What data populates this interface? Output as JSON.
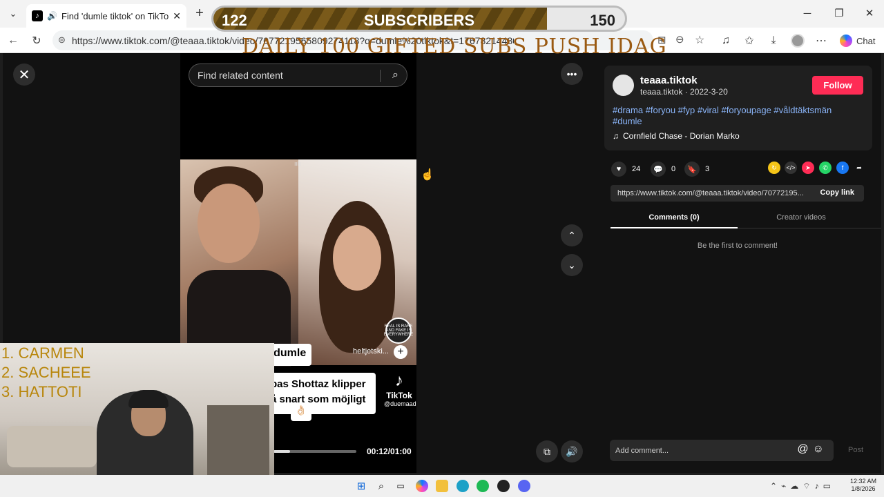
{
  "browser": {
    "tab_title": "Find 'dumle tiktok' on TikTok |",
    "url": "https://www.tiktok.com/@teaaa.tiktok/video/7077219565809274118?q=dumle%20tiktok&t=1767821448003",
    "chat_label": "Chat"
  },
  "overlay": {
    "sub_current": "122",
    "sub_label": "SUBSCRIBERS",
    "sub_goal": "150",
    "sub_progress": 0.81,
    "daily_text": "DAILY 100  GIFTED SUBS PUSH IDAG",
    "ranks": [
      "1.  CARMEN",
      "2.  SACHEEE",
      "3.  HATTOTI"
    ]
  },
  "video": {
    "search_placeholder": "Find related content",
    "caption_1": "är in i dumle",
    "caption_2_line1": "bas Shottaz klipper",
    "caption_2_line2": "å snart som möjligt",
    "caption_3": "👌🏻",
    "watermark_brand": "TikTok",
    "watermark_handle": "@duemaad",
    "handle_overlay": "heltjetski...",
    "badge_text": "REAL IS RARE AND FAKE IS EVERYWHERE",
    "time": "00:12/01:00",
    "progress": 0.2
  },
  "post": {
    "username": "teaaa.tiktok",
    "subline": "teaaa.tiktok · 2022-3-20",
    "follow_label": "Follow",
    "hashtags": "#drama #foryou #fyp #viral #foryoupage #våldtäktsmän #dumle",
    "music": "Cornfield Chase - Dorian Marko",
    "likes": "24",
    "comments": "0",
    "saves": "3",
    "link": "https://www.tiktok.com/@teaaa.tiktok/video/70772195...",
    "copy_label": "Copy link",
    "tab_comments": "Comments (0)",
    "tab_creator": "Creator videos",
    "empty_comments": "Be the first to comment!",
    "add_comment_placeholder": "Add comment...",
    "post_label": "Post"
  },
  "taskbar": {
    "time": "12:32 AM",
    "date": "1/8/2026"
  },
  "colors": {
    "accent_follow": "#fe2c55",
    "hashtag": "#8ab4f8",
    "overlay_gold": "#b8860b"
  }
}
